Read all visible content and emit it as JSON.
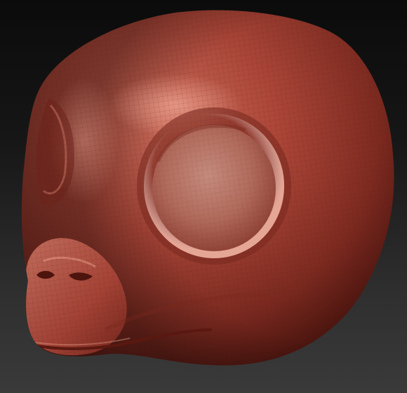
{
  "scene": {
    "subject": "sculpted-creature-head",
    "material_color": "#b0483a",
    "material_highlight": "#e49a86",
    "material_shadow": "#4a140e",
    "wire_color": "#5a1a12",
    "background_top": "#0b0b0b",
    "background_bottom": "#3a3a3a"
  }
}
